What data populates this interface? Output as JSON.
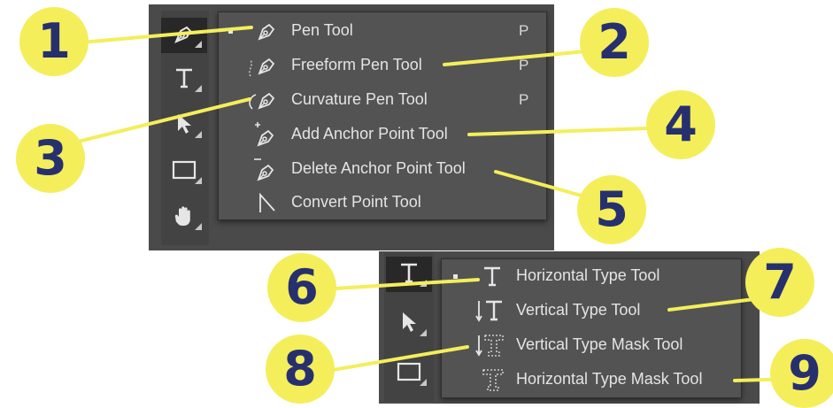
{
  "pen_group": {
    "toolbar": [
      {
        "icon": "pen-icon",
        "active": true
      },
      {
        "icon": "type-icon",
        "active": false
      },
      {
        "icon": "move-arrow-icon",
        "active": false
      },
      {
        "icon": "rectangle-icon",
        "active": false
      },
      {
        "icon": "hand-icon",
        "active": false
      }
    ],
    "items": [
      {
        "label": "Pen Tool",
        "shortcut": "P",
        "icon": "pen-icon",
        "selected": true
      },
      {
        "label": "Freeform Pen Tool",
        "shortcut": "P",
        "icon": "freeform-pen-icon",
        "selected": false
      },
      {
        "label": "Curvature Pen Tool",
        "shortcut": "P",
        "icon": "curvature-pen-icon",
        "selected": false
      },
      {
        "label": "Add Anchor Point Tool",
        "shortcut": "",
        "icon": "add-anchor-point-icon",
        "selected": false
      },
      {
        "label": "Delete Anchor Point Tool",
        "shortcut": "",
        "icon": "delete-anchor-point-icon",
        "selected": false
      },
      {
        "label": "Convert Point Tool",
        "shortcut": "",
        "icon": "convert-point-icon",
        "selected": false
      }
    ]
  },
  "type_group": {
    "toolbar": [
      {
        "icon": "type-icon",
        "active": true
      },
      {
        "icon": "move-arrow-icon",
        "active": false
      },
      {
        "icon": "rectangle-icon",
        "active": false
      }
    ],
    "items": [
      {
        "label": "Horizontal Type Tool",
        "icon": "horizontal-type-icon",
        "selected": true
      },
      {
        "label": "Vertical Type Tool",
        "icon": "vertical-type-icon",
        "selected": false
      },
      {
        "label": "Vertical Type Mask Tool",
        "icon": "vertical-type-mask-icon",
        "selected": false
      },
      {
        "label": "Horizontal Type Mask Tool",
        "icon": "horizontal-type-mask-icon",
        "selected": false
      }
    ]
  },
  "callouts": [
    "1",
    "2",
    "3",
    "4",
    "5",
    "6",
    "7",
    "8",
    "9"
  ],
  "colors": {
    "badge_fill": "#f4ee5b",
    "badge_text": "#27306e",
    "panel_bg": "#535353",
    "toolbar_bg": "#434343",
    "text": "#e4e4e4"
  }
}
